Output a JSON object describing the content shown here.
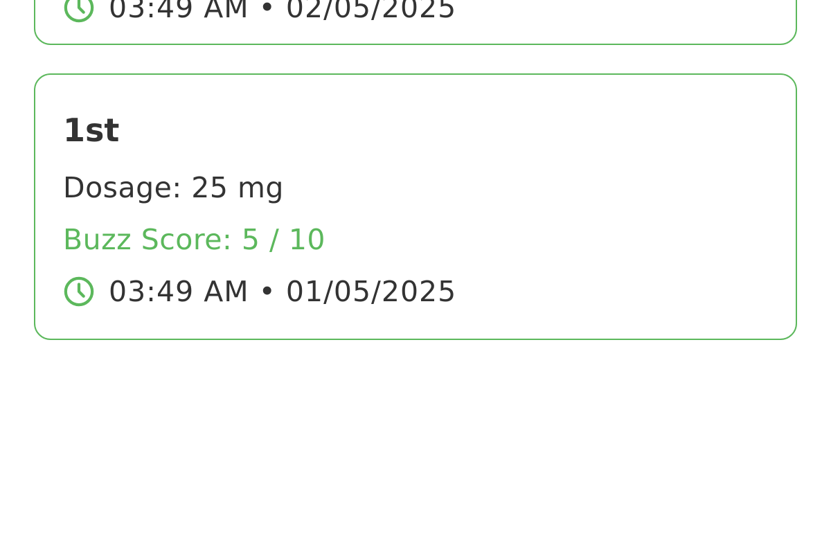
{
  "colors": {
    "accent": "#5cb85c",
    "text": "#333333",
    "background": "#ffffff"
  },
  "entries": [
    {
      "time": "03:49 AM",
      "separator": "•",
      "date": "02/05/2025",
      "icon": "clock-icon"
    },
    {
      "title": "1st",
      "dosage": "Dosage: 25 mg",
      "buzz_score": "Buzz Score: 5 / 10",
      "time": "03:49 AM",
      "separator": "•",
      "date": "01/05/2025",
      "icon": "clock-icon"
    }
  ]
}
